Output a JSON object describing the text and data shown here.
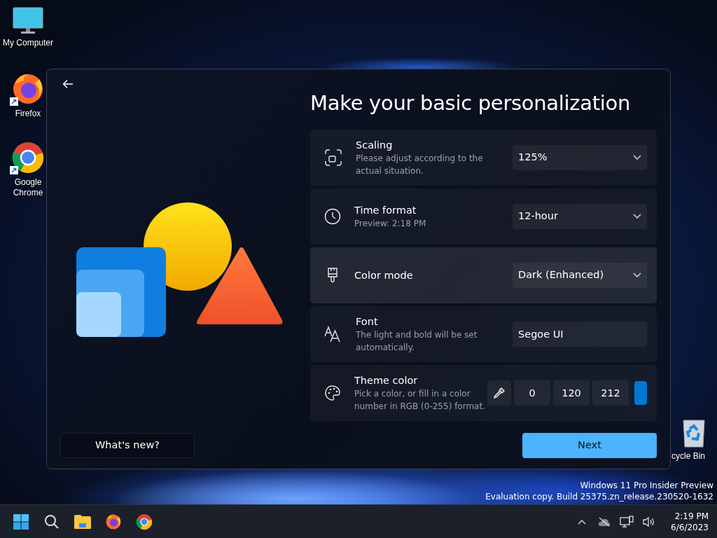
{
  "desktop_icons": [
    {
      "kind": "computer",
      "label": "My Computer",
      "shortcut": false
    },
    {
      "kind": "firefox",
      "label": "Firefox",
      "shortcut": true
    },
    {
      "kind": "chrome",
      "label": "Google Chrome",
      "shortcut": true
    },
    {
      "kind": "recycle",
      "label": "cycle Bin",
      "shortcut": false
    }
  ],
  "dialog": {
    "title": "Make your basic personalization",
    "rows": [
      {
        "kind": "dropdown",
        "title": "Scaling",
        "description": "Please adjust according to the actual situation.",
        "value": "125%",
        "highlighted": false
      },
      {
        "kind": "dropdown",
        "title": "Time format",
        "description": "Preview: 2:18 PM",
        "value": "12-hour",
        "highlighted": false
      },
      {
        "kind": "dropdown",
        "title": "Color mode",
        "value": "Dark (Enhanced)",
        "highlighted": true
      },
      {
        "kind": "text",
        "title": "Font",
        "description": "The light and bold will be set automatically.",
        "value": "Segoe UI",
        "highlighted": false
      },
      {
        "kind": "rgb",
        "title": "Theme color",
        "description": "Pick a color, or fill in a color number in RGB (0-255) format.",
        "values": [
          "0",
          "120",
          "212"
        ],
        "highlighted": false
      }
    ],
    "secondary_button": "What's new?",
    "primary_button": "Next"
  },
  "watermark": [
    "Windows 11 Pro Insider Preview",
    "Evaluation copy. Build 25375.zn_release.230520-1632"
  ],
  "taskbar": {
    "apps": [
      {
        "kind": "start"
      },
      {
        "kind": "search"
      },
      {
        "kind": "explorer"
      },
      {
        "kind": "firefox"
      },
      {
        "kind": "chrome"
      }
    ],
    "tray": [
      {
        "kind": "chevron"
      },
      {
        "kind": "cloud-off"
      },
      {
        "kind": "network"
      },
      {
        "kind": "volume"
      }
    ],
    "time": "2:19 PM",
    "date": "6/6/2023"
  }
}
